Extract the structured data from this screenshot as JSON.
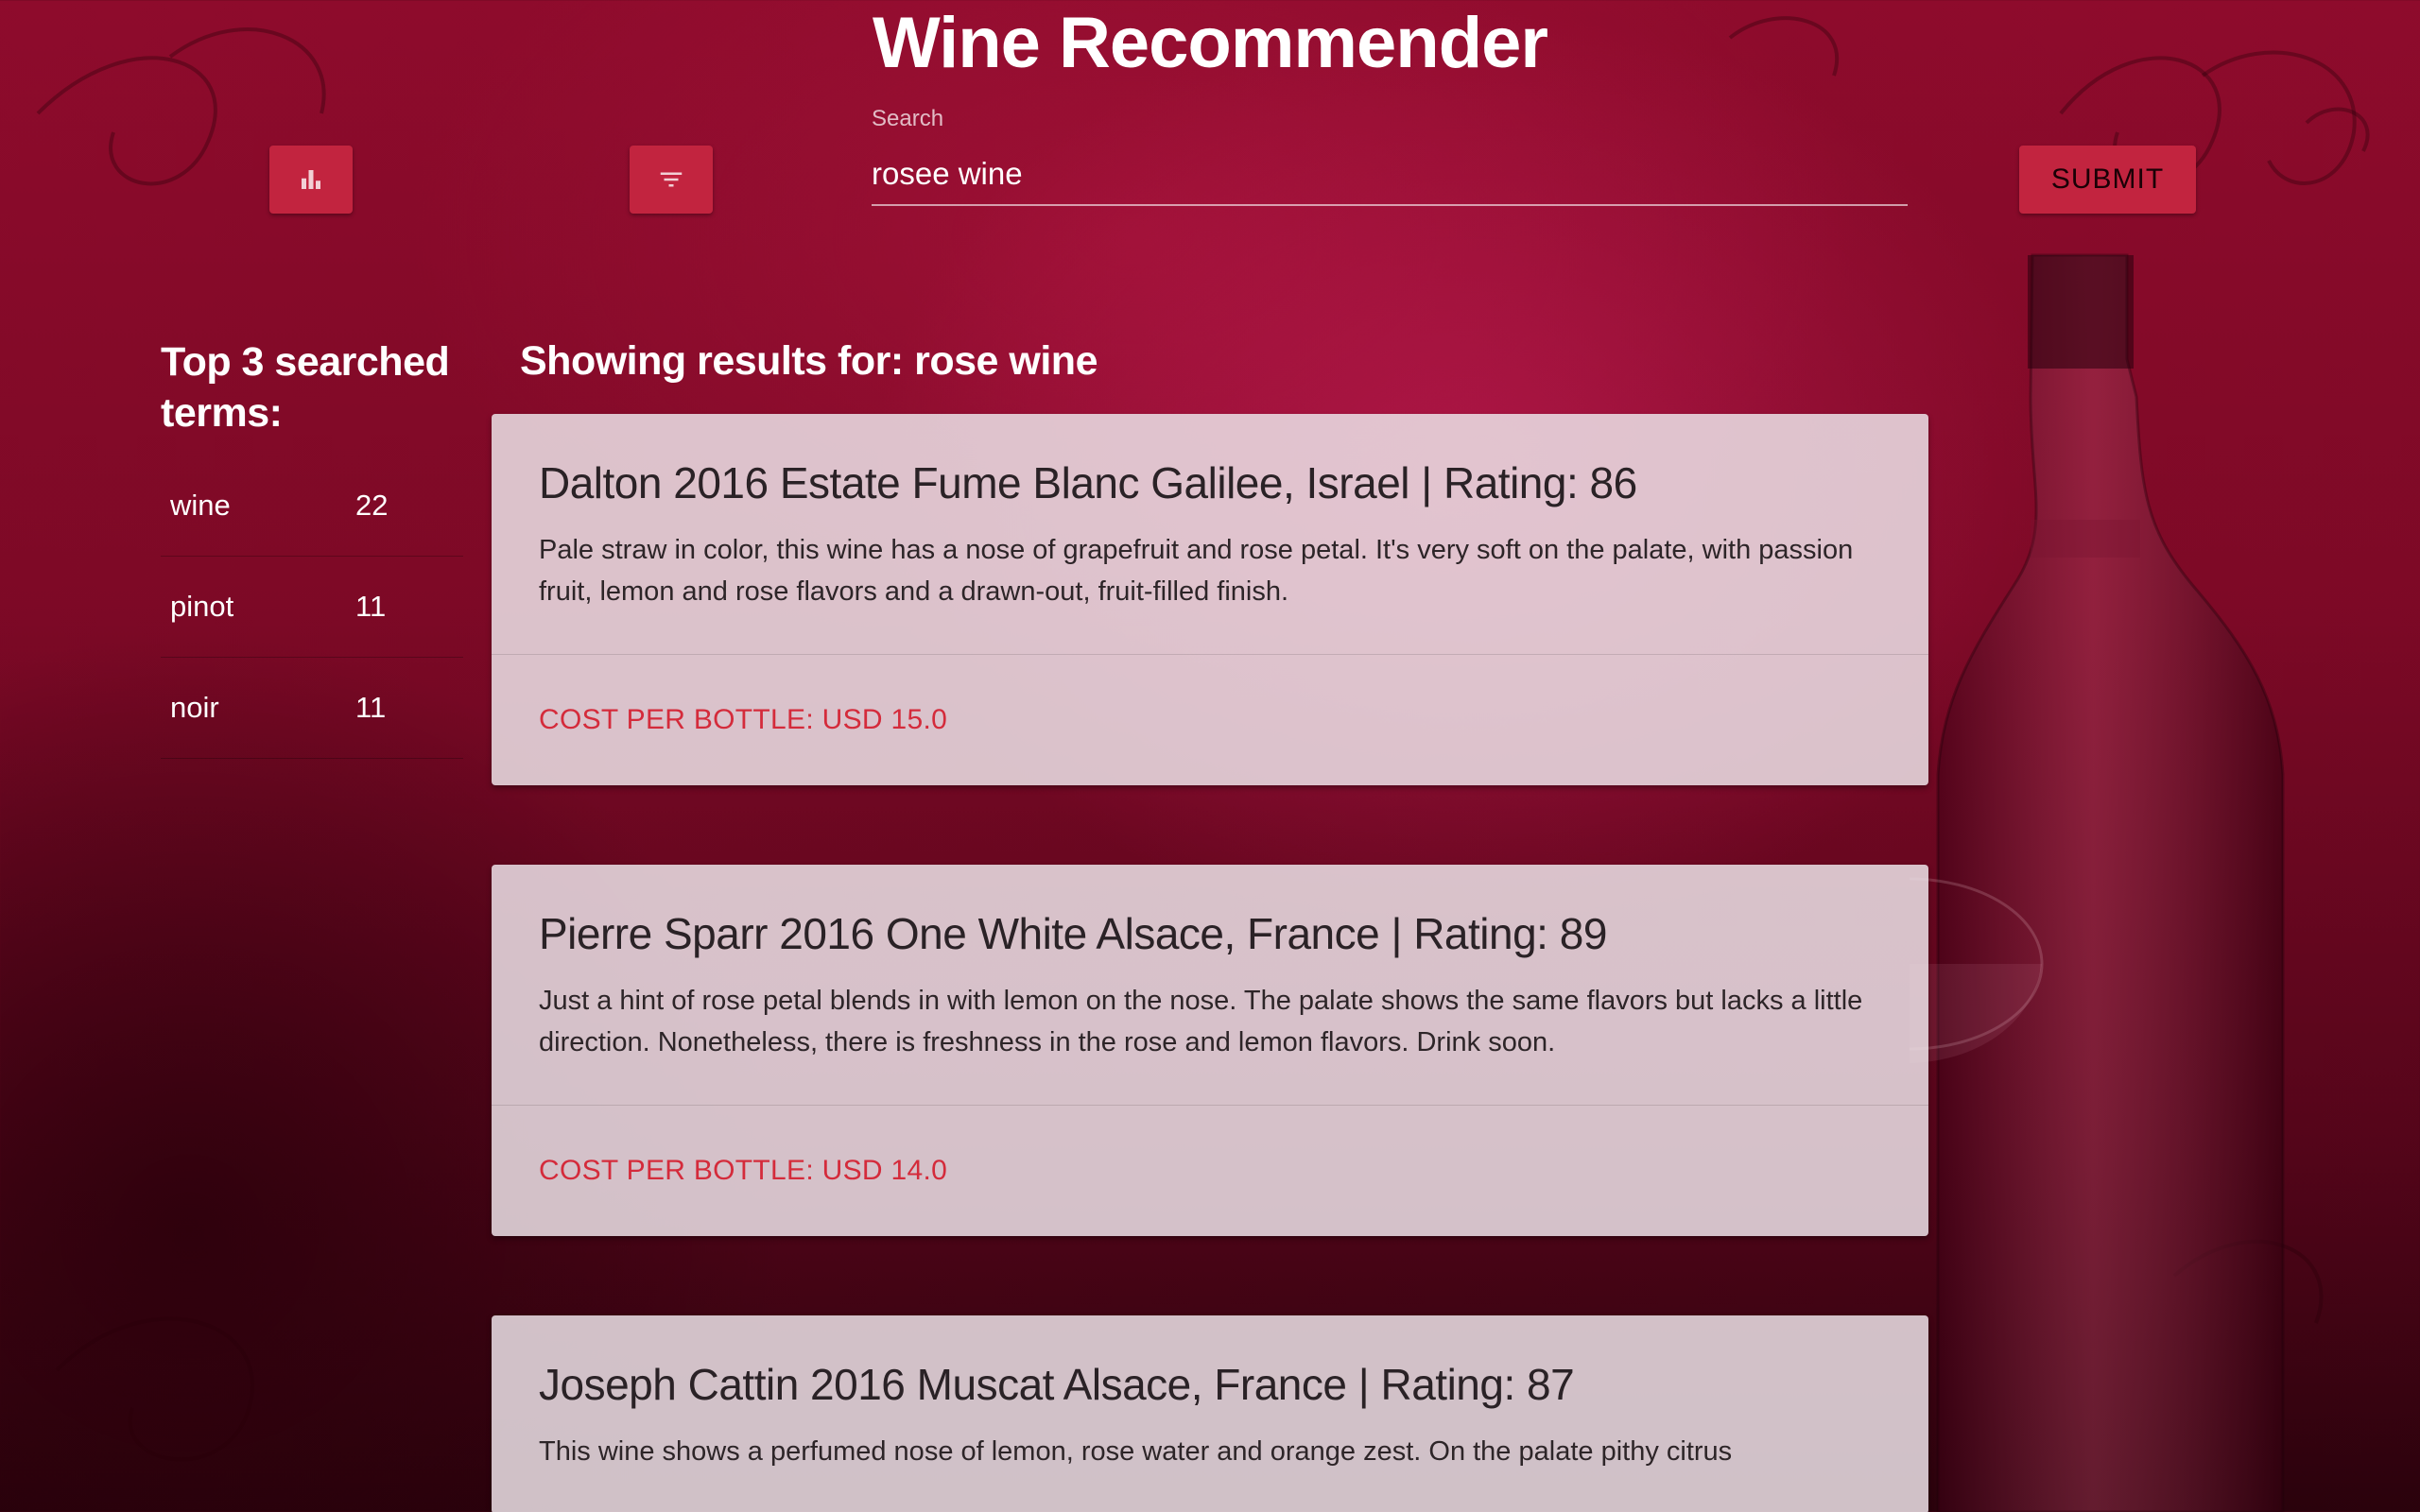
{
  "app": {
    "title": "Wine Recommender"
  },
  "toolbar": {
    "stats_icon": "bar-chart-icon",
    "filter_icon": "filter-icon",
    "submit_label": "SUBMIT"
  },
  "search": {
    "label": "Search",
    "value": "rosee wine"
  },
  "top_terms": {
    "heading": "Top 3 searched terms:",
    "items": [
      {
        "term": "wine",
        "count": "22"
      },
      {
        "term": "pinot",
        "count": "11"
      },
      {
        "term": "noir",
        "count": "11"
      }
    ]
  },
  "results": {
    "heading": "Showing results for: rose wine",
    "items": [
      {
        "title": "Dalton 2016 Estate Fume Blanc Galilee, Israel | Rating: 86",
        "description": "Pale straw in color, this wine has a nose of grapefruit and rose petal. It's very soft on the palate, with passion fruit, lemon and rose flavors and a drawn-out, fruit-filled finish.",
        "cost": "COST PER BOTTLE: USD 15.0"
      },
      {
        "title": "Pierre Sparr 2016 One White Alsace, France | Rating: 89",
        "description": "Just a hint of rose petal blends in with lemon on the nose. The palate shows the same flavors but lacks a little direction. Nonetheless, there is freshness in the rose and lemon flavors. Drink soon.",
        "cost": "COST PER BOTTLE: USD 14.0"
      },
      {
        "title": "Joseph Cattin 2016 Muscat Alsace, France | Rating: 87",
        "description": "This wine shows a perfumed nose of lemon, rose water and orange zest. On the palate pithy citrus"
      }
    ]
  },
  "colors": {
    "accent": "#c2243f",
    "cost_text": "#d42b3b",
    "card_bg": "#ebe1e6",
    "background": "#8e0b2c"
  }
}
